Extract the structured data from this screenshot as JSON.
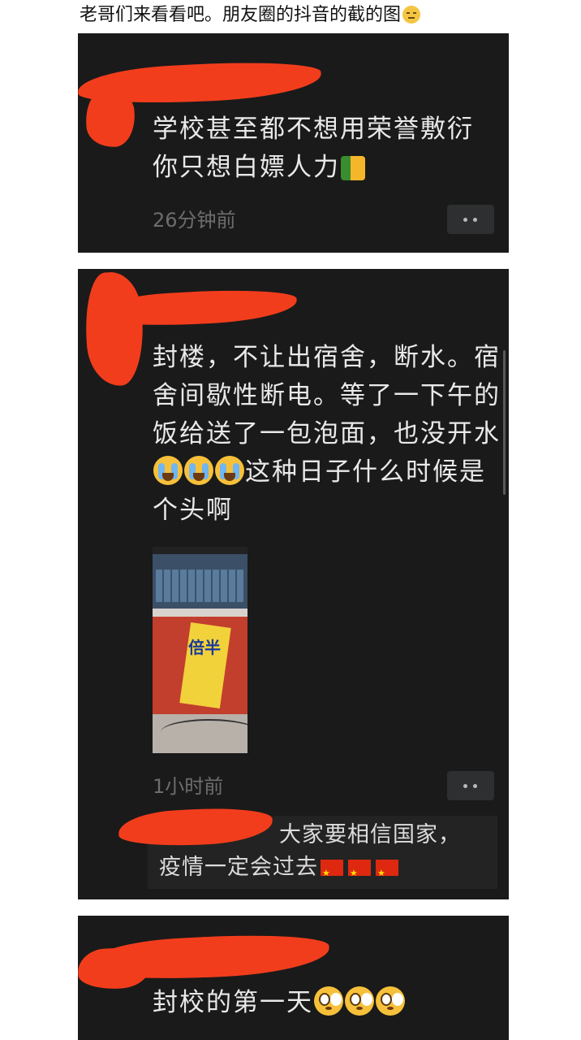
{
  "header": {
    "title": "老哥们来看看吧。朋友圈的抖音的截的图",
    "emoji": "unamused-face-icon"
  },
  "posts": [
    {
      "text": "学校甚至都不想用荣誉敷衍你只想白嫖人力",
      "emoji": "thumbs-up-icon",
      "timestamp": "26分钟前"
    },
    {
      "text": "封楼，不让出宿舍，断水。宿舍间歇性断电。等了一下午的饭给送了一包泡面，也没开水",
      "emoji_after": "loudly-crying-face-icon",
      "text_tail": "这种日子什么时候是个头啊",
      "photo": "instant-noodle-photo",
      "photo_label": "倍半",
      "timestamp": "1小时前",
      "comment": {
        "line1": "大家要相信国家，",
        "line2": "疫情一定会过去",
        "emoji": "china-flag-icon"
      }
    },
    {
      "text": "封校的第一天",
      "emoji": "flushed-face-icon"
    }
  ],
  "colors": {
    "card_bg": "#1a1a1a",
    "redaction": "#f23d1c",
    "text": "#e9e9e9",
    "timestamp": "#6d6d6d"
  }
}
